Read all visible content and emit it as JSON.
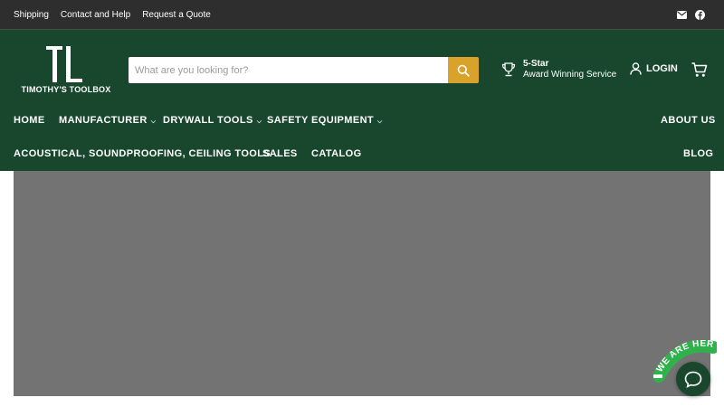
{
  "topbar": {
    "links": [
      "Shipping",
      "Contact and Help",
      "Request a Quote"
    ],
    "social_icons": [
      "mail-icon",
      "facebook-icon"
    ]
  },
  "header": {
    "logo_text": "TIMOTHY'S TOOLBOX",
    "search": {
      "placeholder": "What are you looking for?",
      "value": ""
    },
    "award": {
      "title": "5-Star",
      "subtitle": "Award Winning Service"
    },
    "login_label": "LOGIN",
    "cart_icon": "cart-icon"
  },
  "nav": {
    "row1": [
      {
        "label": "HOME",
        "dropdown": false
      },
      {
        "label": "MANUFACTURER",
        "dropdown": true
      },
      {
        "label": "DRYWALL TOOLS",
        "dropdown": true
      },
      {
        "label": "SAFETY EQUIPMENT",
        "dropdown": true
      },
      {
        "label": "ABOUT US",
        "dropdown": false
      }
    ],
    "row2": [
      {
        "label": "ACOUSTICAL, SOUNDPROOFING, CEILING TOOLS",
        "dropdown": true
      },
      {
        "label": "SALES",
        "dropdown": false
      },
      {
        "label": "CATALOG",
        "dropdown": false
      },
      {
        "label": "BLOG",
        "dropdown": false
      }
    ]
  },
  "chat": {
    "badge_text": "WE ARE HERE!"
  },
  "colors": {
    "header_bg": "#18472e",
    "topbar_bg": "#2e2e2e",
    "search_button": "#d9a22a",
    "hero_bg": "#737373",
    "chat_green": "#2fb24c"
  }
}
